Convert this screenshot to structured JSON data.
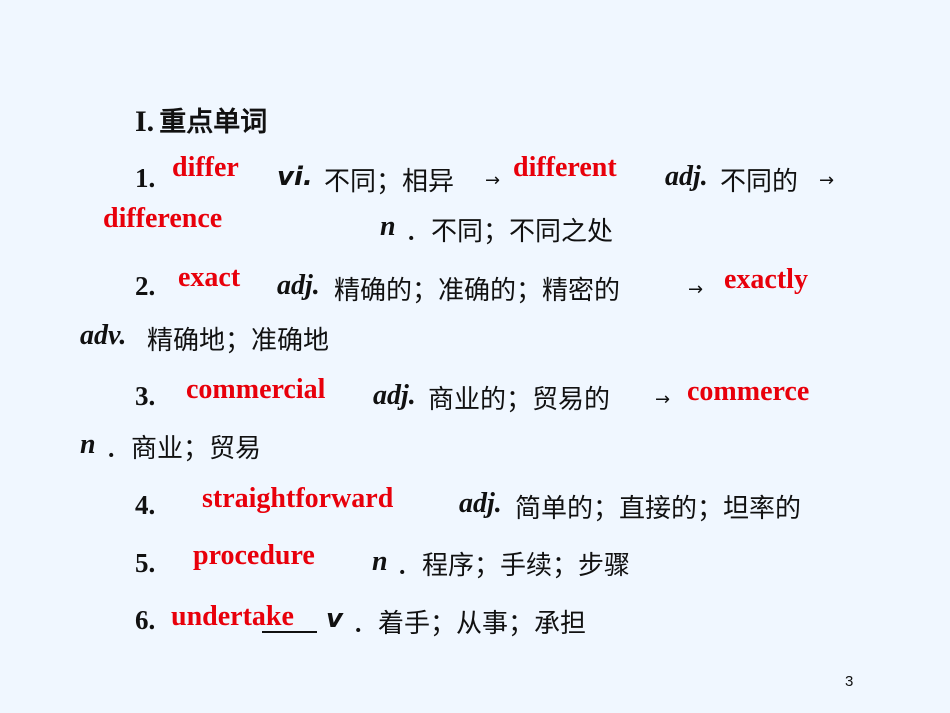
{
  "slide": {
    "heading": {
      "numeral": "I.",
      "title": "重点单词"
    },
    "items": [
      {
        "number": "1.",
        "answer": "differ",
        "pos": "vi.",
        "meaning": "不同；相异",
        "arrow": "→",
        "derived": [
          {
            "answer": "different",
            "pos": "adj.",
            "meaning": "不同的",
            "arrow": "→"
          },
          {
            "answer": "difference",
            "pos": "n",
            "meaning": "．不同；不同之处"
          }
        ]
      },
      {
        "number": "2.",
        "answer": "exact",
        "pos": "adj.",
        "meaning": "精确的；准确的；精密的",
        "arrow": "→",
        "derived": [
          {
            "answer": "exactly",
            "pos": "adv.",
            "meaning": "精确地；准确地"
          }
        ]
      },
      {
        "number": "3.",
        "answer": "commercial",
        "pos": "adj.",
        "meaning": "商业的；贸易的",
        "arrow": "→",
        "derived": [
          {
            "answer": "commerce",
            "pos": "n",
            "meaning": "．商业；贸易"
          }
        ]
      },
      {
        "number": "4.",
        "answer": "straightforward",
        "pos": "adj.",
        "meaning": "简单的；直接的；坦率的"
      },
      {
        "number": "5.",
        "answer": "procedure",
        "pos": "n",
        "meaning": "．程序；手续；步骤"
      },
      {
        "number": "6.",
        "answer": "undertake",
        "pos": "v",
        "meaning": "．着手；从事；承担"
      }
    ],
    "page_number": "3",
    "colors": {
      "background": "#f0f7ff",
      "answer": "#e8000b",
      "text": "#111111"
    }
  }
}
